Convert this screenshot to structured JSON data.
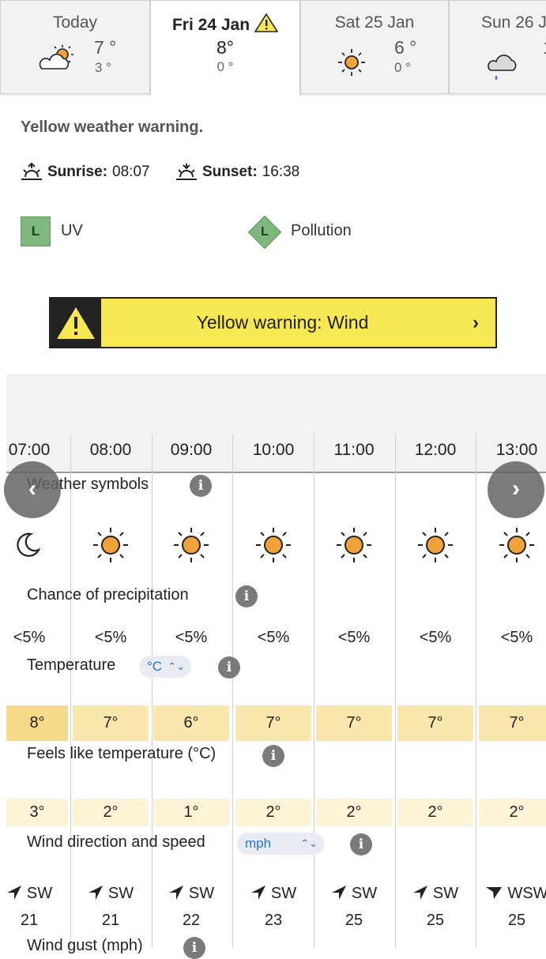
{
  "tabs": [
    {
      "name": "Today",
      "high": "7 °",
      "low": "3 °",
      "icon": "sun-cloud-icon"
    },
    {
      "name": "Fri 24 Jan",
      "high": "8°",
      "low": "0 °",
      "icon": "warning-icon",
      "active": true
    },
    {
      "name": "Sat 25 Jan",
      "high": "6 °",
      "low": "0 °",
      "icon": "sun-icon"
    },
    {
      "name": "Sun 26 J",
      "high": "1",
      "low": "",
      "icon": "rain-cloud-icon"
    }
  ],
  "summary": {
    "warning_title": "Yellow weather warning.",
    "sunrise_label": "Sunrise:",
    "sunrise_time": "08:07",
    "sunset_label": "Sunset:",
    "sunset_time": "16:38",
    "uv_level": "L",
    "uv_label": "UV",
    "pollution_level": "L",
    "pollution_label": "Pollution"
  },
  "banner": {
    "text": "Yellow warning: Wind",
    "bg_color": "#f7e753"
  },
  "hourly": {
    "hours": [
      "07:00",
      "08:00",
      "09:00",
      "10:00",
      "11:00",
      "12:00",
      "13:00"
    ],
    "symbols_label": "Weather symbols",
    "symbols": [
      "moon-icon",
      "sun-icon",
      "sun-icon",
      "sun-icon",
      "sun-icon",
      "sun-icon",
      "sun-icon"
    ],
    "precip_label": "Chance of precipitation",
    "precip": [
      "<5%",
      "<5%",
      "<5%",
      "<5%",
      "<5%",
      "<5%",
      "<5%"
    ],
    "temp_label": "Temperature",
    "temp_unit": "°C",
    "temps": [
      "8°",
      "7°",
      "6°",
      "7°",
      "7°",
      "7°",
      "7°"
    ],
    "feels_label": "Feels like temperature (°C)",
    "feels": [
      "3°",
      "2°",
      "1°",
      "2°",
      "2°",
      "2°",
      "2°"
    ],
    "wind_label": "Wind direction and speed",
    "wind_unit": "mph",
    "wind_dirs": [
      "SW",
      "SW",
      "SW",
      "SW",
      "SW",
      "SW",
      "WSW"
    ],
    "wind_speeds": [
      "21",
      "21",
      "22",
      "23",
      "25",
      "25",
      "25"
    ],
    "gust_label": "Wind gust (mph)"
  },
  "colors": {
    "accent_blue": "#2a6fd6",
    "temp_warm": "#f7d98a",
    "temp_mild": "#fbe7ae",
    "feels_cool": "#fdf3d6"
  }
}
